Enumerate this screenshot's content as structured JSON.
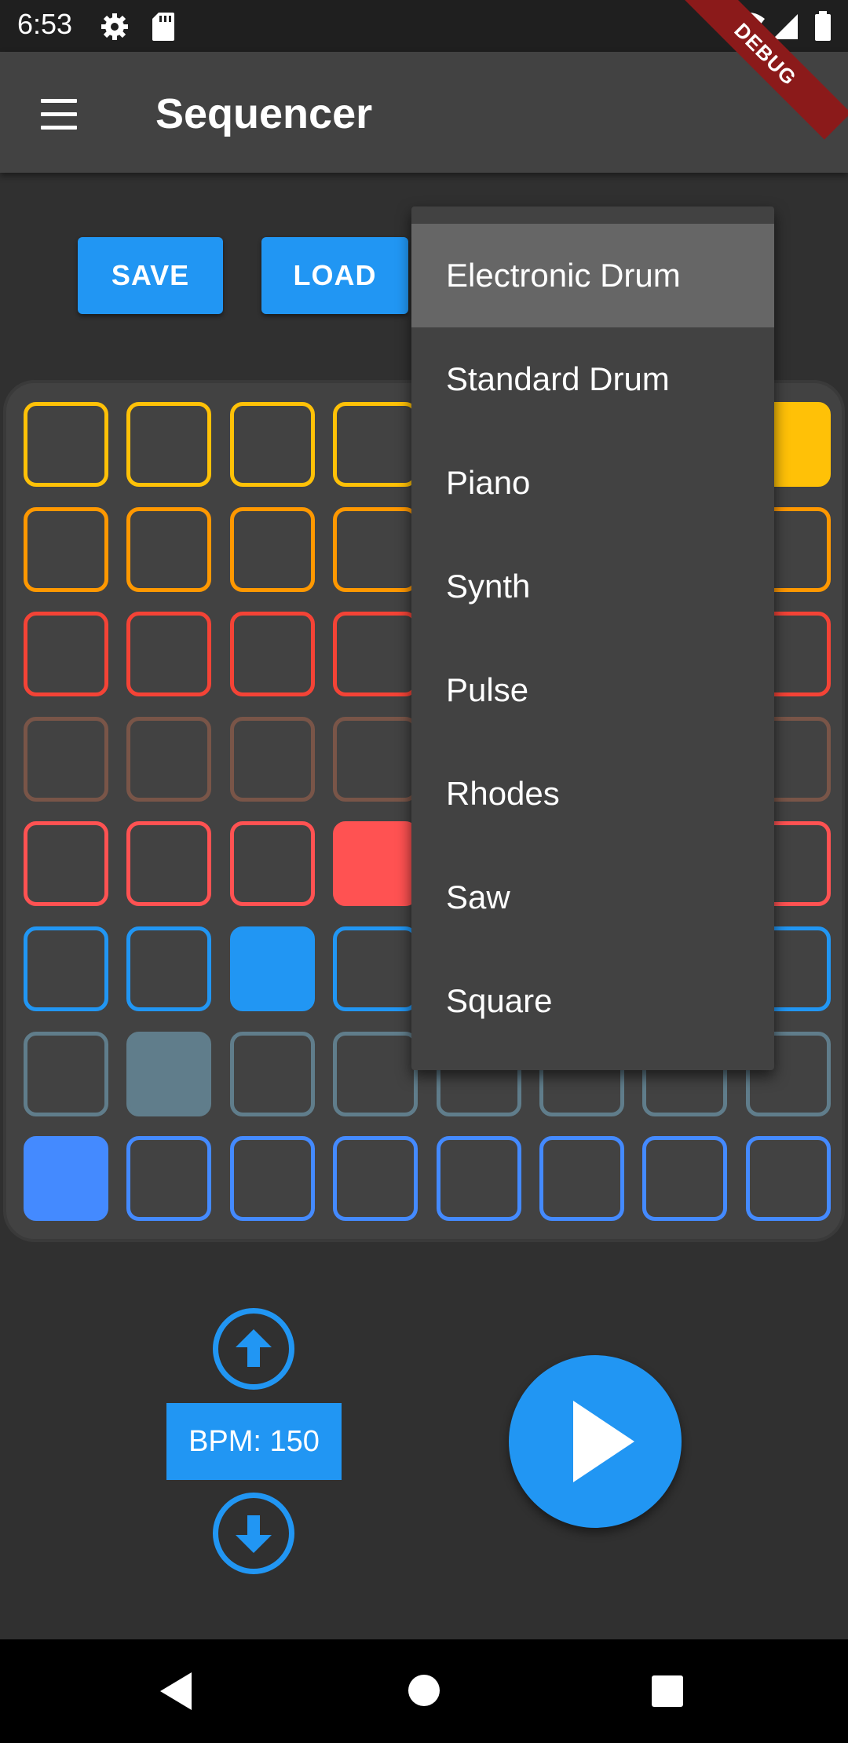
{
  "status_bar": {
    "time": "6:53",
    "icons": [
      "gear-icon",
      "sd-card-icon",
      "wifi-icon",
      "signal-icon",
      "battery-icon"
    ]
  },
  "app_bar": {
    "title": "Sequencer",
    "menu_icon": "hamburger-menu-icon",
    "debug_banner": "DEBUG"
  },
  "actions": {
    "save_label": "SAVE",
    "load_label": "LOAD"
  },
  "instrument_dropdown": {
    "selected": "Electronic Drum",
    "options": [
      "Electronic Drum",
      "Standard Drum",
      "Piano",
      "Synth",
      "Pulse",
      "Rhodes",
      "Saw",
      "Square"
    ]
  },
  "grid": {
    "columns": 8,
    "rows": [
      {
        "color": "#ffc107",
        "active": [
          7
        ]
      },
      {
        "color": "#ff9800",
        "active": []
      },
      {
        "color": "#f44336",
        "active": []
      },
      {
        "color": "#795548",
        "active": []
      },
      {
        "color": "#ff5252",
        "active": [
          3
        ]
      },
      {
        "color": "#2196f3",
        "active": [
          2
        ]
      },
      {
        "color": "#607d8b",
        "active": [
          1
        ]
      },
      {
        "color": "#448aff",
        "active": [
          0
        ]
      }
    ]
  },
  "tempo": {
    "label": "BPM: 150",
    "up_icon": "arrow-up-circle-icon",
    "down_icon": "arrow-down-circle-icon"
  },
  "playback": {
    "play_icon": "play-icon"
  },
  "nav_bar": {
    "icons": [
      "back-icon",
      "home-icon",
      "recents-icon"
    ]
  },
  "colors": {
    "accent": "#2196f3",
    "background": "#303030",
    "surface": "#424242"
  }
}
